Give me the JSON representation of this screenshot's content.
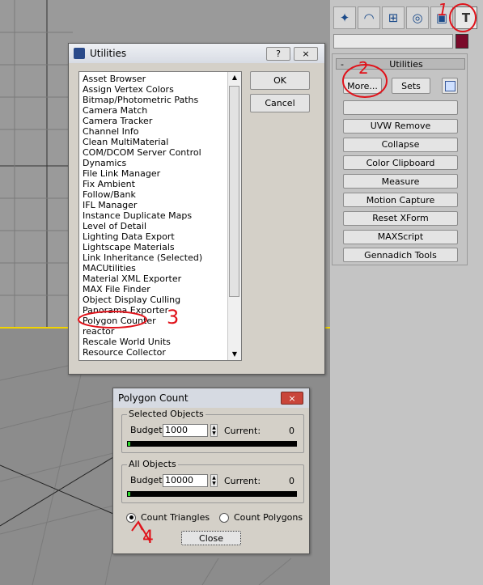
{
  "tabs": [
    {
      "icon": "create-icon"
    },
    {
      "icon": "modify-icon"
    },
    {
      "icon": "hierarchy-icon"
    },
    {
      "icon": "motion-icon"
    },
    {
      "icon": "display-icon"
    },
    {
      "icon": "utilities-hammer-icon"
    }
  ],
  "rollout": {
    "toggle": "-",
    "title": "Utilities",
    "more_label": "More...",
    "sets_label": "Sets",
    "buttons": [
      "",
      "UVW Remove",
      "Collapse",
      "Color Clipboard",
      "Measure",
      "Motion Capture",
      "Reset XForm",
      "MAXScript",
      "Gennadich Tools"
    ]
  },
  "utilities_dialog": {
    "title": "Utilities",
    "help_glyph": "?",
    "close_glyph": "×",
    "ok_label": "OK",
    "cancel_label": "Cancel",
    "items": [
      "Asset Browser",
      "Assign Vertex Colors",
      "Bitmap/Photometric Paths",
      "Camera Match",
      "Camera Tracker",
      "Channel Info",
      "Clean MultiMaterial",
      "COM/DCOM Server Control",
      "Dynamics",
      "File Link Manager",
      "Fix Ambient",
      "Follow/Bank",
      "IFL Manager",
      "Instance Duplicate Maps",
      "Level of Detail",
      "Lighting Data Export",
      "Lightscape Materials",
      "Link Inheritance (Selected)",
      "MACUtilities",
      "Material XML Exporter",
      "MAX File Finder",
      "Object Display Culling",
      "Panorama Exporter",
      "Polygon Counter",
      "reactor",
      "Rescale World Units",
      "Resource Collector"
    ],
    "selected_item": "Polygon Counter"
  },
  "polygon_dialog": {
    "title": "Polygon Count",
    "close_glyph": "×",
    "selected_group": {
      "label": "Selected Objects",
      "budget_label": "Budget:",
      "budget_value": "1000",
      "current_label": "Current:",
      "current_value": "0",
      "progress": 0.0
    },
    "all_group": {
      "label": "All Objects",
      "budget_label": "Budget:",
      "budget_value": "10000",
      "current_label": "Current:",
      "current_value": "0",
      "progress": 0.0
    },
    "count_triangles": "Count Triangles",
    "count_polygons": "Count Polygons",
    "close_label": "Close"
  },
  "annotations": [
    "1",
    "2",
    "3",
    "4"
  ],
  "colors": {
    "annotation": "#e0121a",
    "swatch": "#7a0a2a",
    "progress_fill": "#2bd62b"
  }
}
